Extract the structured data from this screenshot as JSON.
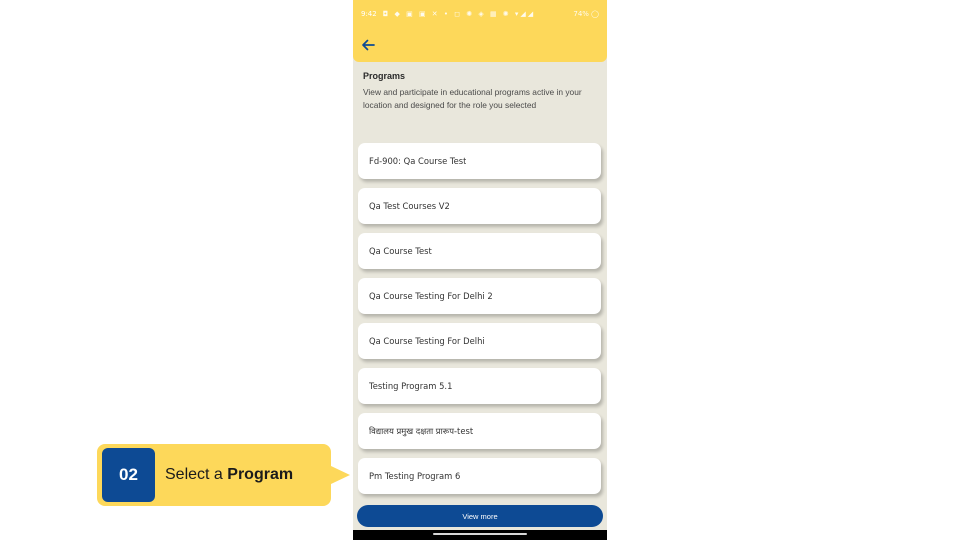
{
  "status_bar": {
    "time": "9:42",
    "icons": "◘ ◆ ▣ ▣ ✕ • ◻ ✺ ◈ ▦ ✺ ▾◢◢",
    "battery": "74% ◯"
  },
  "header": {
    "title": "Programs",
    "description": "View and participate in educational programs active in your location and designed for the role you selected"
  },
  "programs": [
    {
      "label": "Fd-900: Qa Course Test"
    },
    {
      "label": "Qa Test Courses V2"
    },
    {
      "label": "Qa Course Test"
    },
    {
      "label": "Qa Course Testing For Delhi 2"
    },
    {
      "label": "Qa Course Testing For Delhi"
    },
    {
      "label": "Testing Program 5.1"
    },
    {
      "label": "विद्यालय प्रमुख दक्षता प्रारूप-test"
    },
    {
      "label": "Pm Testing Program 6"
    }
  ],
  "view_more_label": "View more",
  "callout": {
    "step": "02",
    "prefix": "Select a ",
    "emphasis": "Program"
  },
  "colors": {
    "accent_yellow": "#fdd85a",
    "primary_blue": "#0d4a94",
    "background": "#e9e7dc"
  },
  "icons": {
    "back": "arrow-left-icon"
  }
}
